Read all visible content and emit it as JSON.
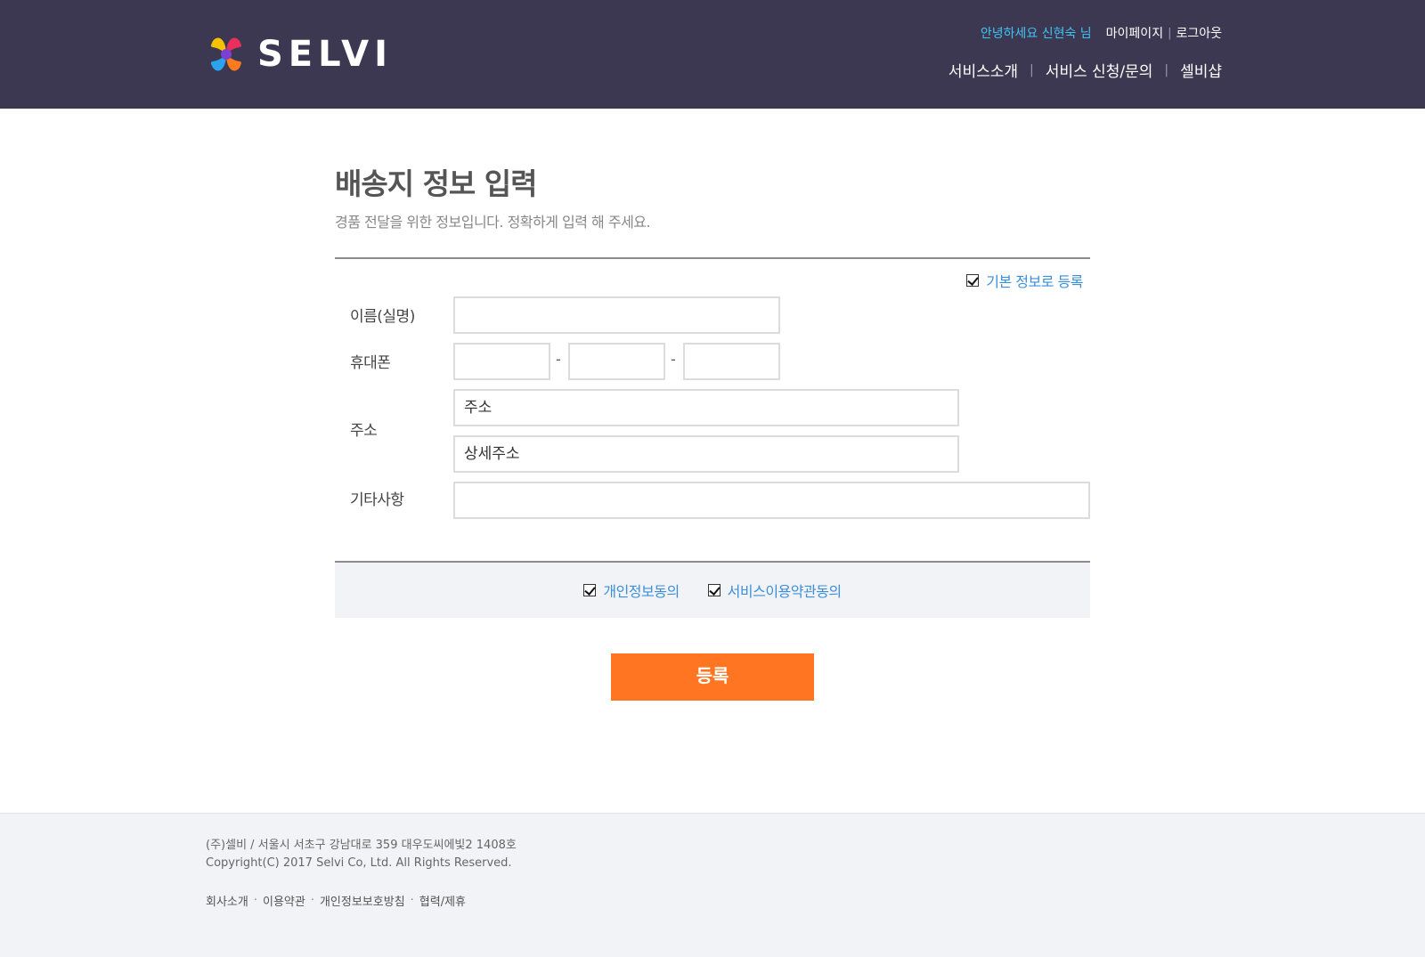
{
  "header": {
    "brand": "SELVI",
    "greeting": "안녕하세요 신현숙 님",
    "util_links": [
      "마이페이지",
      "로그아웃"
    ],
    "nav": [
      "서비스소개",
      "서비스 신청/문의",
      "셀비샵"
    ],
    "colors": {
      "background": "#3d3852",
      "greeting": "#3fc4f4"
    }
  },
  "form": {
    "title": "배송지 정보 입력",
    "description": "경품 전달을 위한 정보입니다. 정확하게 입력 해 주세요.",
    "save_default_label": "기본 정보로 등록",
    "save_default_checked": true,
    "name_label": "이름(실명)",
    "name_value": "",
    "phone_label": "휴대폰",
    "phone_values": [
      "",
      "",
      ""
    ],
    "phone_separator": "-",
    "address_label": "주소",
    "address_placeholder": "주소",
    "address_detail_placeholder": "상세주소",
    "etc_label": "기타사항",
    "etc_value": ""
  },
  "agreements": [
    {
      "label": "개인정보동의",
      "checked": true
    },
    {
      "label": "서비스이용약관동의",
      "checked": true
    }
  ],
  "submit_label": "등록",
  "submit_color": "#ff7522",
  "footer": {
    "address": "(주)셀비 / 서울시 서초구 강남대로 359 대우도씨에빛2 1408호",
    "copyright": "Copyright(C) 2017 Selvi Co, Ltd. All Rights Reserved.",
    "links": [
      "회사소개",
      "이용약관",
      "개인정보보호방침",
      "협력/제휴"
    ],
    "link_separator": "·"
  }
}
